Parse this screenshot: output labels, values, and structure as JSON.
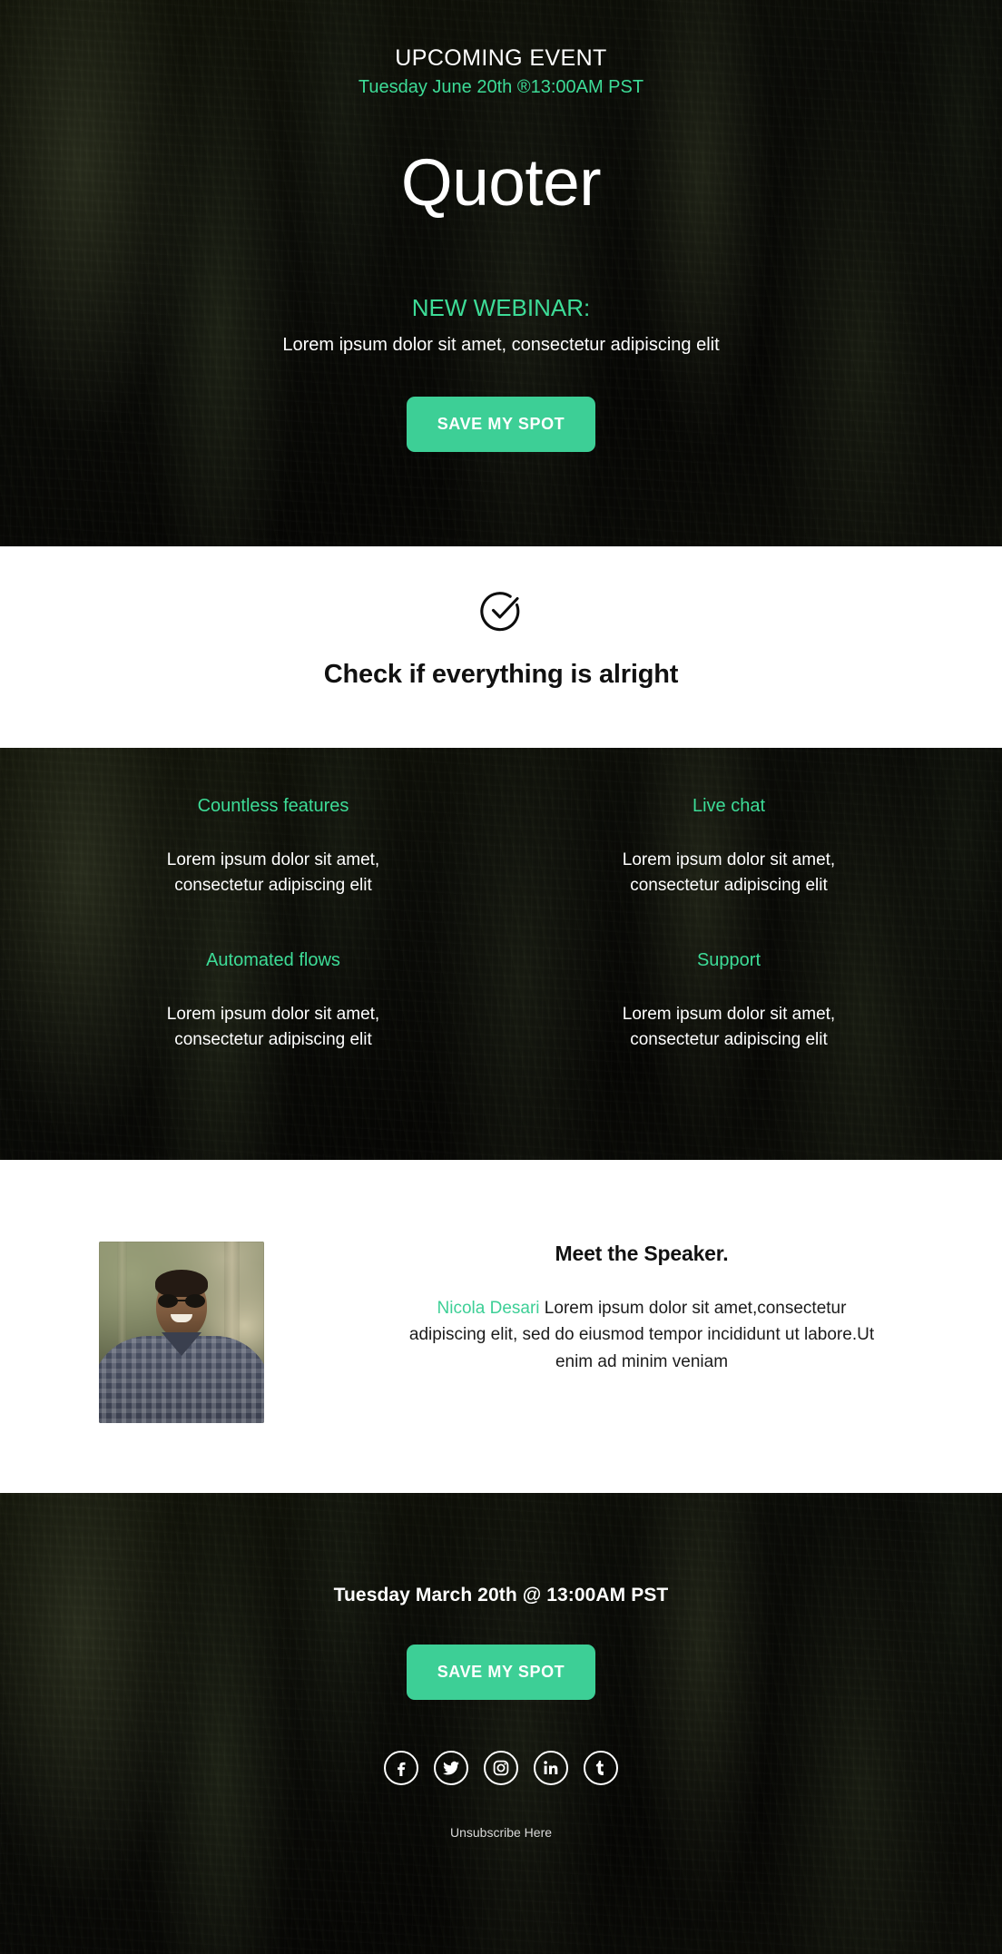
{
  "hero": {
    "eyebrow": "UPCOMING EVENT",
    "event_date": "Tuesday June 20th ®13:00AM PST",
    "brand_title": "Quoter",
    "webinar_label": "NEW WEBINAR:",
    "webinar_desc": "Lorem ipsum dolor sit amet, consectetur adipiscing elit",
    "cta_label": "SAVE MY SPOT"
  },
  "check": {
    "icon": "check-circle-icon",
    "heading": "Check if everything is alright"
  },
  "features": [
    {
      "title": "Countless features",
      "body": "Lorem ipsum dolor sit amet, consectetur adipiscing elit"
    },
    {
      "title": "Live chat",
      "body": "Lorem ipsum dolor sit amet, consectetur adipiscing elit"
    },
    {
      "title": "Automated flows",
      "body": "Lorem ipsum dolor sit amet, consectetur adipiscing elit"
    },
    {
      "title": "Support",
      "body": "Lorem ipsum dolor sit amet, consectetur adipiscing elit"
    }
  ],
  "speaker": {
    "photo_alt": "speaker-portrait",
    "heading": "Meet the Speaker.",
    "name": "Nicola Desari",
    "bio": " Lorem ipsum dolor sit amet,consectetur adipiscing elit, sed do eiusmod tempor incididunt ut labore.Ut enim ad minim veniam"
  },
  "footer": {
    "date": "Tuesday March 20th @ 13:00AM PST",
    "cta_label": "SAVE MY SPOT",
    "social": [
      {
        "name": "facebook-icon",
        "label": "f"
      },
      {
        "name": "twitter-icon",
        "label": "t"
      },
      {
        "name": "instagram-icon",
        "label": "ig"
      },
      {
        "name": "linkedin-icon",
        "label": "in"
      },
      {
        "name": "tumblr-icon",
        "label": "t"
      }
    ],
    "unsubscribe_label": "Unsubscribe Here"
  },
  "colors": {
    "accent_green": "#3ddc97",
    "button_green": "#3dcf96",
    "dark_bg": "#0b0c08",
    "light_bg": "#ffffff",
    "text_light": "#ffffff",
    "text_dark": "#111111"
  }
}
